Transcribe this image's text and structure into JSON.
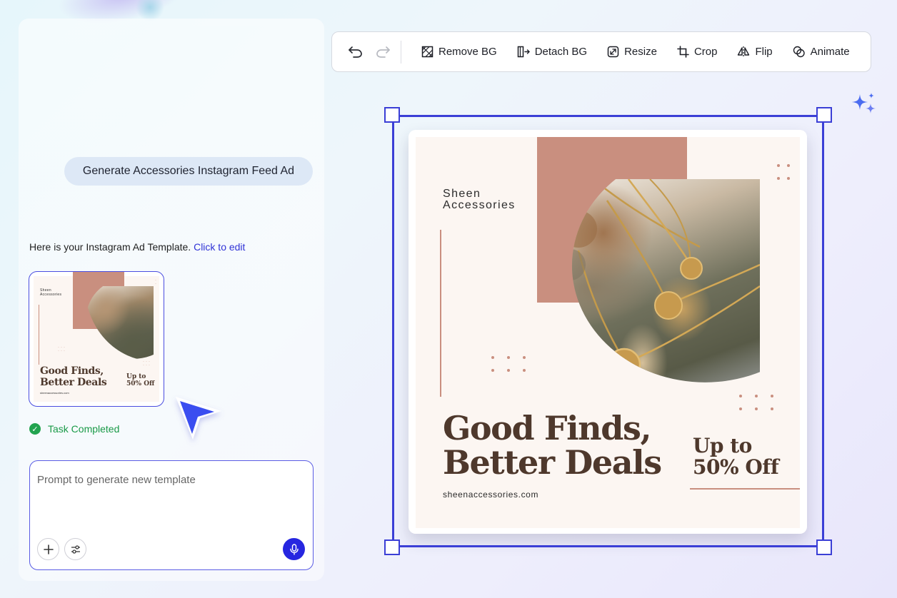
{
  "chat": {
    "user_message": "Generate Accessories Instagram Feed Ad",
    "reply_text": "Here is your Instagram Ad Template.",
    "reply_link": "Click to edit",
    "task_status": "Task Completed"
  },
  "template_preview": {
    "brand_line1": "Sheen",
    "brand_line2": "Accessories",
    "headline_line1": "Good Finds,",
    "headline_line2": "Better Deals",
    "offer_line1": "Up to",
    "offer_line2": "50% Off",
    "url": "sheenaccessories.com"
  },
  "prompt": {
    "placeholder": "Prompt to generate new template",
    "value": ""
  },
  "toolbar": {
    "undo_icon": "undo-icon",
    "redo_icon": "redo-icon",
    "remove_bg": "Remove BG",
    "detach_bg": "Detach BG",
    "resize": "Resize",
    "crop": "Crop",
    "flip": "Flip",
    "animate": "Animate"
  },
  "canvas_ad": {
    "brand_line1": "Sheen",
    "brand_line2": "Accessories",
    "headline_line1": "Good Finds,",
    "headline_line2": "Better Deals",
    "offer_line1": "Up to",
    "offer_line2": "50% Off",
    "url": "sheenaccessories.com"
  },
  "colors": {
    "accent": "#3b3fd6",
    "brand_terracotta": "#c98f7f",
    "headline_brown": "#4e382c",
    "success_green": "#22a34f",
    "mic_blue": "#2626e0"
  }
}
